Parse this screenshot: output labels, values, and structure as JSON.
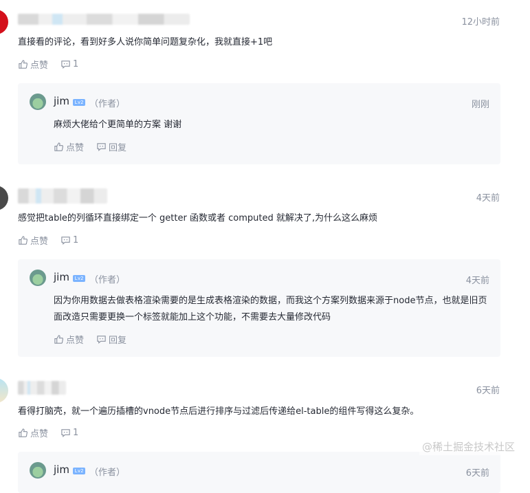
{
  "comments": [
    {
      "time": "12小时前",
      "text": "直接看的评论，看到好多人说你简单问题复杂化，我就直接+1吧",
      "like_label": "点赞",
      "comment_count": "1",
      "avatar_color": "#d4101b",
      "reply": {
        "name": "jim",
        "badge": "Lv2",
        "author_tag": "（作者）",
        "time": "刚刚",
        "text": "麻烦大佬给个更简单的方案 谢谢",
        "like_label": "点赞",
        "reply_label": "回复"
      }
    },
    {
      "time": "4天前",
      "text": "感觉把table的列循环直接绑定一个 getter 函数或者 computed 就解决了,为什么这么麻烦",
      "like_label": "点赞",
      "comment_count": "1",
      "avatar_color": "#4a4a4a",
      "reply": {
        "name": "jim",
        "badge": "Lv2",
        "author_tag": "（作者）",
        "time": "4天前",
        "text": "因为你用数据去做表格渲染需要的是生成表格渲染的数据，而我这个方案列数据来源于node节点，也就是旧页面改造只需要更换一个标签就能加上这个功能，不需要去大量修改代码",
        "like_label": "点赞",
        "reply_label": "回复"
      }
    },
    {
      "time": "6天前",
      "text": "看得打脑壳，就一个遍历插槽的vnode节点后进行排序与过滤后传递给el-table的组件写得这么复杂。",
      "like_label": "点赞",
      "comment_count": "1",
      "avatar_color": "#7cc7e0",
      "reply": {
        "name": "jim",
        "badge": "Lv2",
        "author_tag": "（作者）",
        "time": "6天前"
      }
    }
  ],
  "watermark": "@稀土掘金技术社区",
  "colors": {
    "text": "#252933",
    "muted": "#8a919f",
    "reply_bg": "#f7f8fa",
    "badge": "#7ab3ff"
  }
}
